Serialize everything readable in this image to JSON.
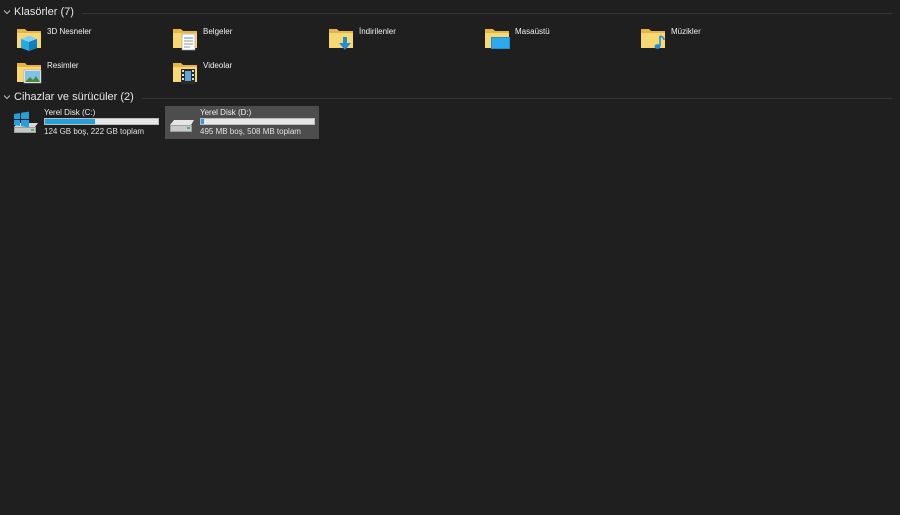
{
  "sections": {
    "folders": {
      "title": "Klasörler (7)"
    },
    "drives": {
      "title": "Cihazlar ve sürücüler (2)"
    }
  },
  "folders": [
    {
      "label": "3D Nesneler",
      "icon": "3d-objects-folder-icon"
    },
    {
      "label": "Belgeler",
      "icon": "documents-folder-icon"
    },
    {
      "label": "İndirilenler",
      "icon": "downloads-folder-icon"
    },
    {
      "label": "Masaüstü",
      "icon": "desktop-folder-icon"
    },
    {
      "label": "Müzikler",
      "icon": "music-folder-icon"
    },
    {
      "label": "Resimler",
      "icon": "pictures-folder-icon"
    },
    {
      "label": "Videolar",
      "icon": "videos-folder-icon"
    }
  ],
  "drives": [
    {
      "label": "Yerel Disk (C:)",
      "info": "124 GB boş, 222 GB toplam",
      "used_fraction": 0.44,
      "icon": "windows-drive-icon",
      "selected": false
    },
    {
      "label": "Yerel Disk (D:)",
      "info": "495 MB boş, 508 MB toplam",
      "used_fraction": 0.03,
      "icon": "hard-drive-icon",
      "selected": true
    }
  ],
  "colors": {
    "background": "#1f1f1f",
    "selection": "#4d4d4d",
    "usage_bar": "#26a0da",
    "folder": "#f3c95a"
  }
}
